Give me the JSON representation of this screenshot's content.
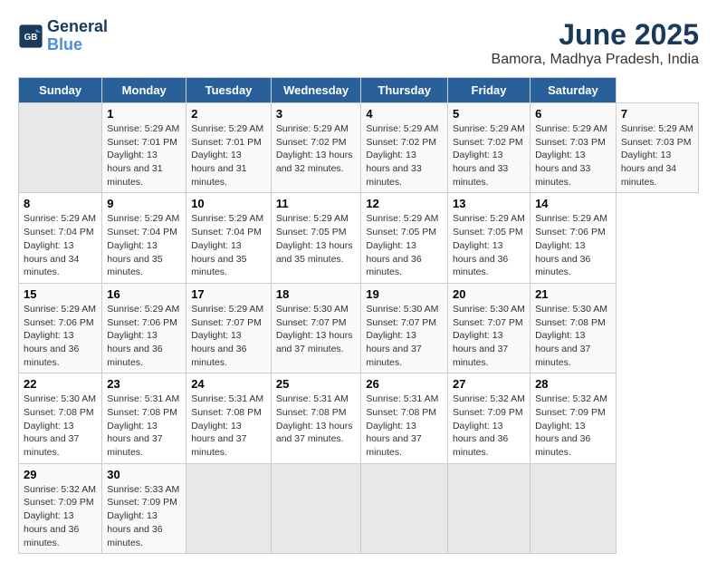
{
  "logo": {
    "line1": "General",
    "line2": "Blue"
  },
  "title": "June 2025",
  "subtitle": "Bamora, Madhya Pradesh, India",
  "headers": [
    "Sunday",
    "Monday",
    "Tuesday",
    "Wednesday",
    "Thursday",
    "Friday",
    "Saturday"
  ],
  "rows": [
    [
      {
        "day": "",
        "empty": true
      },
      {
        "day": "1",
        "sunrise": "Sunrise: 5:29 AM",
        "sunset": "Sunset: 7:01 PM",
        "daylight": "Daylight: 13 hours and 31 minutes."
      },
      {
        "day": "2",
        "sunrise": "Sunrise: 5:29 AM",
        "sunset": "Sunset: 7:01 PM",
        "daylight": "Daylight: 13 hours and 31 minutes."
      },
      {
        "day": "3",
        "sunrise": "Sunrise: 5:29 AM",
        "sunset": "Sunset: 7:02 PM",
        "daylight": "Daylight: 13 hours and 32 minutes."
      },
      {
        "day": "4",
        "sunrise": "Sunrise: 5:29 AM",
        "sunset": "Sunset: 7:02 PM",
        "daylight": "Daylight: 13 hours and 33 minutes."
      },
      {
        "day": "5",
        "sunrise": "Sunrise: 5:29 AM",
        "sunset": "Sunset: 7:02 PM",
        "daylight": "Daylight: 13 hours and 33 minutes."
      },
      {
        "day": "6",
        "sunrise": "Sunrise: 5:29 AM",
        "sunset": "Sunset: 7:03 PM",
        "daylight": "Daylight: 13 hours and 33 minutes."
      },
      {
        "day": "7",
        "sunrise": "Sunrise: 5:29 AM",
        "sunset": "Sunset: 7:03 PM",
        "daylight": "Daylight: 13 hours and 34 minutes."
      }
    ],
    [
      {
        "day": "8",
        "sunrise": "Sunrise: 5:29 AM",
        "sunset": "Sunset: 7:04 PM",
        "daylight": "Daylight: 13 hours and 34 minutes."
      },
      {
        "day": "9",
        "sunrise": "Sunrise: 5:29 AM",
        "sunset": "Sunset: 7:04 PM",
        "daylight": "Daylight: 13 hours and 35 minutes."
      },
      {
        "day": "10",
        "sunrise": "Sunrise: 5:29 AM",
        "sunset": "Sunset: 7:04 PM",
        "daylight": "Daylight: 13 hours and 35 minutes."
      },
      {
        "day": "11",
        "sunrise": "Sunrise: 5:29 AM",
        "sunset": "Sunset: 7:05 PM",
        "daylight": "Daylight: 13 hours and 35 minutes."
      },
      {
        "day": "12",
        "sunrise": "Sunrise: 5:29 AM",
        "sunset": "Sunset: 7:05 PM",
        "daylight": "Daylight: 13 hours and 36 minutes."
      },
      {
        "day": "13",
        "sunrise": "Sunrise: 5:29 AM",
        "sunset": "Sunset: 7:05 PM",
        "daylight": "Daylight: 13 hours and 36 minutes."
      },
      {
        "day": "14",
        "sunrise": "Sunrise: 5:29 AM",
        "sunset": "Sunset: 7:06 PM",
        "daylight": "Daylight: 13 hours and 36 minutes."
      }
    ],
    [
      {
        "day": "15",
        "sunrise": "Sunrise: 5:29 AM",
        "sunset": "Sunset: 7:06 PM",
        "daylight": "Daylight: 13 hours and 36 minutes."
      },
      {
        "day": "16",
        "sunrise": "Sunrise: 5:29 AM",
        "sunset": "Sunset: 7:06 PM",
        "daylight": "Daylight: 13 hours and 36 minutes."
      },
      {
        "day": "17",
        "sunrise": "Sunrise: 5:29 AM",
        "sunset": "Sunset: 7:07 PM",
        "daylight": "Daylight: 13 hours and 36 minutes."
      },
      {
        "day": "18",
        "sunrise": "Sunrise: 5:30 AM",
        "sunset": "Sunset: 7:07 PM",
        "daylight": "Daylight: 13 hours and 37 minutes."
      },
      {
        "day": "19",
        "sunrise": "Sunrise: 5:30 AM",
        "sunset": "Sunset: 7:07 PM",
        "daylight": "Daylight: 13 hours and 37 minutes."
      },
      {
        "day": "20",
        "sunrise": "Sunrise: 5:30 AM",
        "sunset": "Sunset: 7:07 PM",
        "daylight": "Daylight: 13 hours and 37 minutes."
      },
      {
        "day": "21",
        "sunrise": "Sunrise: 5:30 AM",
        "sunset": "Sunset: 7:08 PM",
        "daylight": "Daylight: 13 hours and 37 minutes."
      }
    ],
    [
      {
        "day": "22",
        "sunrise": "Sunrise: 5:30 AM",
        "sunset": "Sunset: 7:08 PM",
        "daylight": "Daylight: 13 hours and 37 minutes."
      },
      {
        "day": "23",
        "sunrise": "Sunrise: 5:31 AM",
        "sunset": "Sunset: 7:08 PM",
        "daylight": "Daylight: 13 hours and 37 minutes."
      },
      {
        "day": "24",
        "sunrise": "Sunrise: 5:31 AM",
        "sunset": "Sunset: 7:08 PM",
        "daylight": "Daylight: 13 hours and 37 minutes."
      },
      {
        "day": "25",
        "sunrise": "Sunrise: 5:31 AM",
        "sunset": "Sunset: 7:08 PM",
        "daylight": "Daylight: 13 hours and 37 minutes."
      },
      {
        "day": "26",
        "sunrise": "Sunrise: 5:31 AM",
        "sunset": "Sunset: 7:08 PM",
        "daylight": "Daylight: 13 hours and 37 minutes."
      },
      {
        "day": "27",
        "sunrise": "Sunrise: 5:32 AM",
        "sunset": "Sunset: 7:09 PM",
        "daylight": "Daylight: 13 hours and 36 minutes."
      },
      {
        "day": "28",
        "sunrise": "Sunrise: 5:32 AM",
        "sunset": "Sunset: 7:09 PM",
        "daylight": "Daylight: 13 hours and 36 minutes."
      }
    ],
    [
      {
        "day": "29",
        "sunrise": "Sunrise: 5:32 AM",
        "sunset": "Sunset: 7:09 PM",
        "daylight": "Daylight: 13 hours and 36 minutes."
      },
      {
        "day": "30",
        "sunrise": "Sunrise: 5:33 AM",
        "sunset": "Sunset: 7:09 PM",
        "daylight": "Daylight: 13 hours and 36 minutes."
      },
      {
        "day": "",
        "empty": true
      },
      {
        "day": "",
        "empty": true
      },
      {
        "day": "",
        "empty": true
      },
      {
        "day": "",
        "empty": true
      },
      {
        "day": "",
        "empty": true
      }
    ]
  ]
}
